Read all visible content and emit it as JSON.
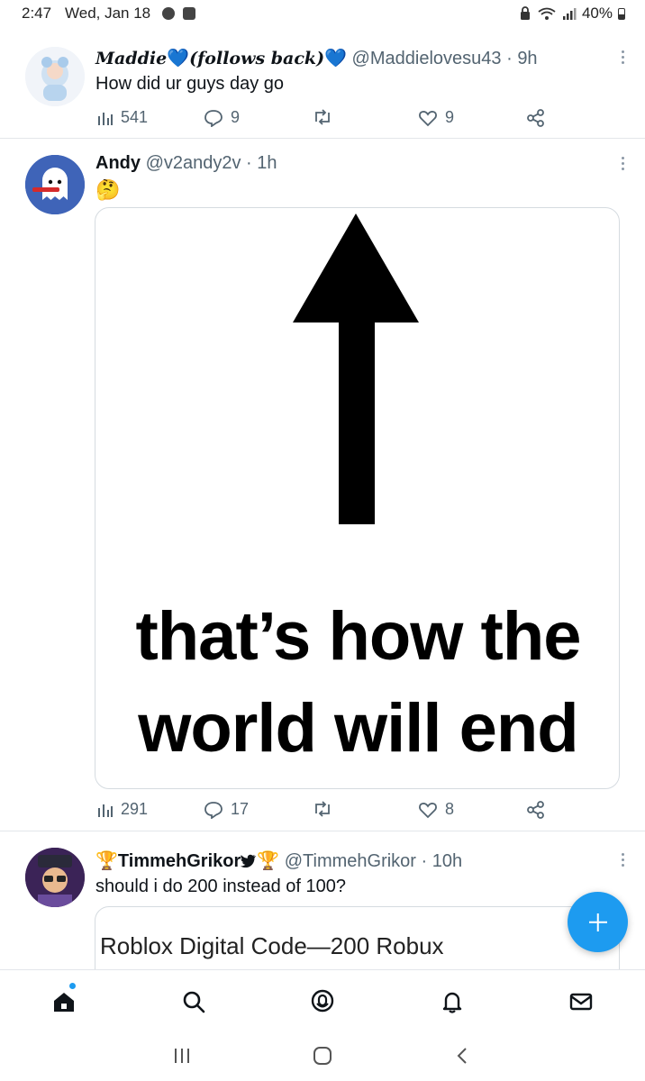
{
  "status_bar": {
    "time": "2:47",
    "date": "Wed, Jan 18",
    "battery": "40%"
  },
  "tweets": [
    {
      "display_name_parts": [
        "Maddie",
        "(follows back)"
      ],
      "handle": "@Maddielovesu43",
      "separator": "·",
      "time": "9h",
      "text": "How did ur guys day go",
      "views": "541",
      "replies": "9",
      "retweets": "",
      "likes": "9",
      "badge_emoji": "💙"
    },
    {
      "display_name": "Andy",
      "handle": "@v2andy2v",
      "separator": "·",
      "time": "1h",
      "text": "🤔",
      "media_lines": [
        "that’s how the",
        "world will end"
      ],
      "views": "291",
      "replies": "17",
      "retweets": "",
      "likes": "8"
    },
    {
      "display_name": "TimmehGrikor",
      "name_emoji_left": "🏆",
      "name_emoji_right": "🏆",
      "handle": "@TimmehGrikor",
      "separator": "·",
      "time": "10h",
      "text": "should i do 200 instead of 100?",
      "card_title": "Roblox Digital Code—200 Robux"
    }
  ],
  "icons": {
    "views": "bar-chart-icon",
    "reply": "speech-bubble-icon",
    "retweet": "retweet-icon",
    "like": "heart-icon",
    "share": "share-icon",
    "compose": "plus-icon"
  },
  "bottom_nav": [
    "home-icon",
    "search-icon",
    "spaces-icon",
    "bell-icon",
    "mail-icon"
  ],
  "colors": {
    "accent": "#1d9bf0",
    "muted": "#536471",
    "heart_blue": "#5aa9e6"
  }
}
